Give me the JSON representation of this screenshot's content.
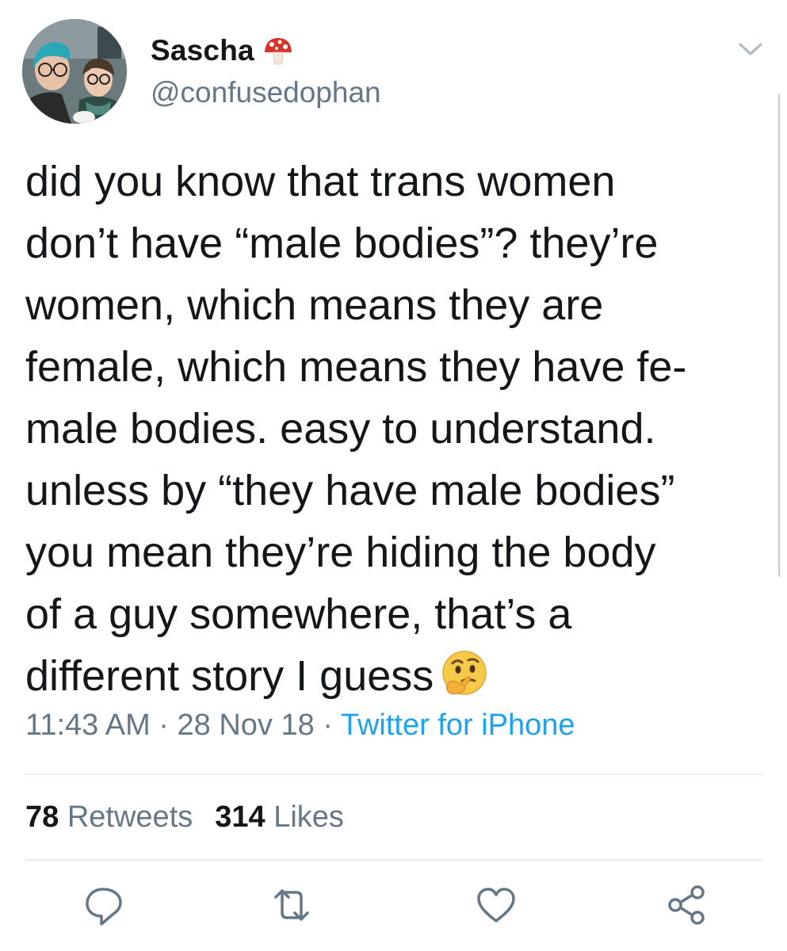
{
  "author": {
    "display_name": "Sascha",
    "name_emoji": "mushroom-icon",
    "handle": "@confusedophan"
  },
  "tweet": {
    "lines": [
      "did you know that trans women",
      "don’t have “male bodies”? they’re",
      "women, which means they are",
      "female, which means they have fe-",
      "male bodies. easy to understand.",
      "unless by “they have male bodies”",
      "you mean they’re hiding the body",
      "of a guy somewhere, that’s a",
      "different story I guess"
    ],
    "trailing_emoji": "thinking-face-icon"
  },
  "meta": {
    "time": "11:43 AM",
    "separator": " · ",
    "date": "28 Nov 18",
    "source": "Twitter for iPhone"
  },
  "stats": {
    "retweets_count": "78",
    "retweets_label": "Retweets",
    "likes_count": "314",
    "likes_label": "Likes"
  },
  "actions": [
    "reply-icon",
    "retweet-icon",
    "like-icon",
    "share-icon"
  ],
  "colors": {
    "text": "#14171a",
    "secondary": "#657786",
    "link": "#1da1f2",
    "divider": "#e6ecf0"
  }
}
